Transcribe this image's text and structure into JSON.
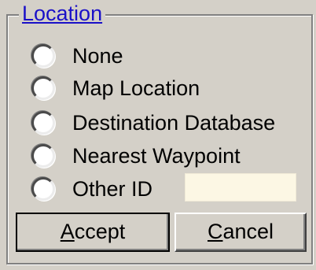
{
  "location_group": {
    "title": "Location",
    "options": [
      {
        "label": "None",
        "selected": false
      },
      {
        "label": "Map Location",
        "selected": false
      },
      {
        "label": "Destination Database",
        "selected": false
      },
      {
        "label": "Nearest Waypoint",
        "selected": false
      },
      {
        "label": "Other ID",
        "selected": false
      }
    ],
    "other_id_value": ""
  },
  "buttons": {
    "accept": {
      "mnemonic": "A",
      "rest": "ccept"
    },
    "cancel": {
      "mnemonic": "C",
      "rest": "ancel"
    }
  },
  "colors": {
    "window_bg": "#d4d0c8",
    "legend_text": "#1a10c8",
    "input_bg": "#fcf7e4"
  }
}
